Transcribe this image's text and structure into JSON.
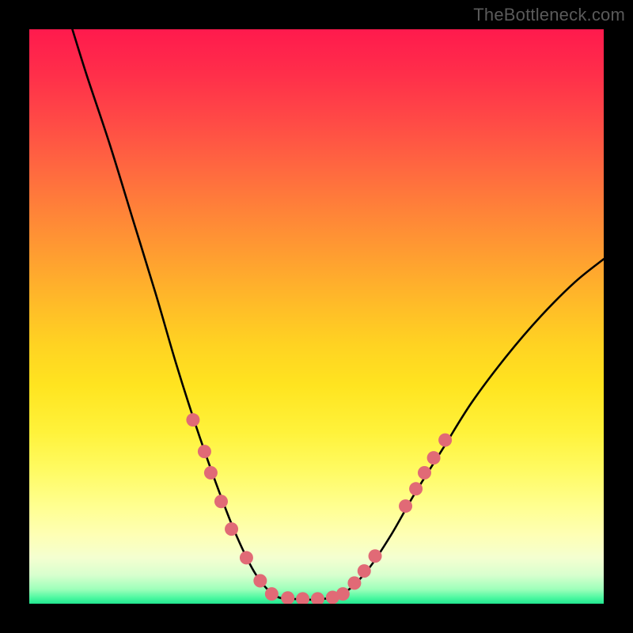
{
  "watermark": "TheBottleneck.com",
  "dot_color": "#e16a76",
  "dot_radius_px": 8.5,
  "chart_data": {
    "type": "line",
    "title": "",
    "xlabel": "",
    "ylabel": "",
    "xlim": [
      0,
      100
    ],
    "ylim": [
      0,
      100
    ],
    "series": [
      {
        "name": "v-curve",
        "style": "smooth-black-line",
        "note": "x is 0-100 across plot width; y is 0-100 bottom-to-top (100=plot top)",
        "points": [
          {
            "x": 7.5,
            "y": 100
          },
          {
            "x": 10,
            "y": 92
          },
          {
            "x": 14,
            "y": 80
          },
          {
            "x": 18,
            "y": 67
          },
          {
            "x": 22,
            "y": 54
          },
          {
            "x": 25.5,
            "y": 42
          },
          {
            "x": 29,
            "y": 31
          },
          {
            "x": 32.5,
            "y": 21
          },
          {
            "x": 36,
            "y": 12
          },
          {
            "x": 39.5,
            "y": 5
          },
          {
            "x": 43,
            "y": 1.3
          },
          {
            "x": 47,
            "y": 0.8
          },
          {
            "x": 51,
            "y": 0.8
          },
          {
            "x": 55,
            "y": 2
          },
          {
            "x": 59,
            "y": 6
          },
          {
            "x": 63,
            "y": 12
          },
          {
            "x": 67,
            "y": 19
          },
          {
            "x": 72,
            "y": 27
          },
          {
            "x": 77,
            "y": 35
          },
          {
            "x": 83,
            "y": 43
          },
          {
            "x": 89,
            "y": 50
          },
          {
            "x": 95,
            "y": 56
          },
          {
            "x": 100,
            "y": 60
          }
        ]
      },
      {
        "name": "dots",
        "style": "red-dots",
        "points": [
          {
            "x": 28.5,
            "y": 32
          },
          {
            "x": 30.5,
            "y": 26.5
          },
          {
            "x": 31.6,
            "y": 22.8
          },
          {
            "x": 33.4,
            "y": 17.8
          },
          {
            "x": 35.2,
            "y": 13
          },
          {
            "x": 37.8,
            "y": 8
          },
          {
            "x": 40.2,
            "y": 4
          },
          {
            "x": 42.2,
            "y": 1.7
          },
          {
            "x": 45,
            "y": 1.0
          },
          {
            "x": 47.6,
            "y": 0.85
          },
          {
            "x": 50.2,
            "y": 0.85
          },
          {
            "x": 52.8,
            "y": 1.1
          },
          {
            "x": 54.6,
            "y": 1.7
          },
          {
            "x": 56.6,
            "y": 3.6
          },
          {
            "x": 58.3,
            "y": 5.7
          },
          {
            "x": 60.2,
            "y": 8.3
          },
          {
            "x": 65.5,
            "y": 17
          },
          {
            "x": 67.3,
            "y": 20
          },
          {
            "x": 68.8,
            "y": 22.8
          },
          {
            "x": 70.4,
            "y": 25.4
          },
          {
            "x": 72.4,
            "y": 28.5
          }
        ]
      }
    ]
  }
}
